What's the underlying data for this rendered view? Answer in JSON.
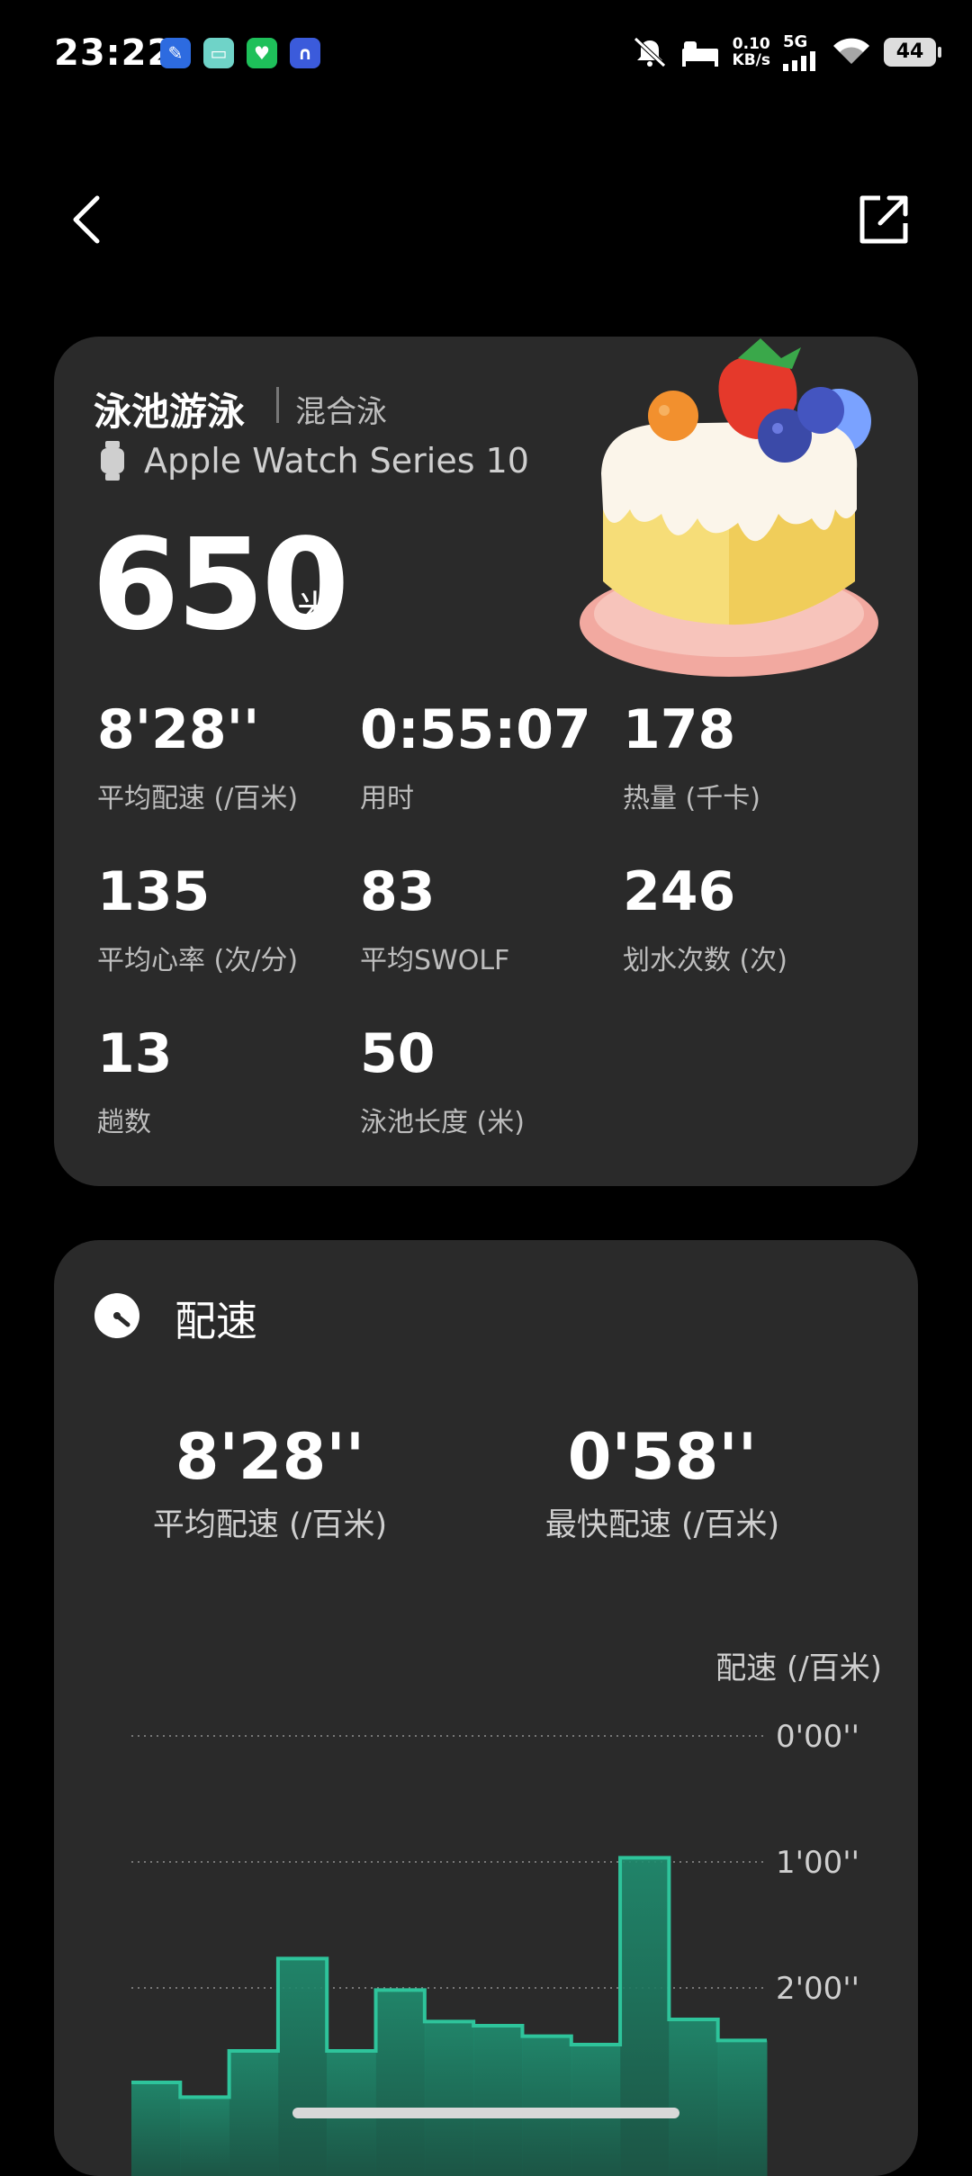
{
  "status_bar": {
    "time": "23:22",
    "net_rate_value": "0.10",
    "net_rate_unit": "KB/s",
    "signal": "5G",
    "battery": "44"
  },
  "workout": {
    "title": "泳池游泳",
    "stroke": "混合泳",
    "device": "Apple Watch Series 10",
    "distance": "650",
    "distance_unit": "米",
    "stats": [
      {
        "value": "8'28''",
        "label": "平均配速 (/百米)"
      },
      {
        "value": "0:55:07",
        "label": "用时"
      },
      {
        "value": "178",
        "label": "热量 (千卡)"
      },
      {
        "value": "135",
        "label": "平均心率 (次/分)"
      },
      {
        "value": "83",
        "label": "平均SWOLF"
      },
      {
        "value": "246",
        "label": "划水次数 (次)"
      },
      {
        "value": "13",
        "label": "趟数"
      },
      {
        "value": "50",
        "label": "泳池长度 (米)"
      }
    ]
  },
  "pace": {
    "title": "配速",
    "avg_value": "8'28''",
    "avg_label": "平均配速 (/百米)",
    "fast_value": "0'58''",
    "fast_label": "最快配速 (/百米)",
    "axis_title": "配速 (/百米)"
  },
  "chart_data": {
    "type": "area",
    "ylabel": "配速 (/百米)",
    "ytick_labels": [
      "0'00''",
      "1'00''",
      "2'00''"
    ],
    "y_inverted": true,
    "y_unit": "seconds per 100m",
    "segments": [
      1,
      2,
      3,
      4,
      5,
      6,
      7,
      8,
      9,
      10,
      11,
      12,
      13
    ],
    "values": [
      165,
      172,
      150,
      106,
      150,
      121,
      136,
      138,
      143,
      147,
      58,
      135,
      145
    ],
    "color": "#2ec49b"
  }
}
